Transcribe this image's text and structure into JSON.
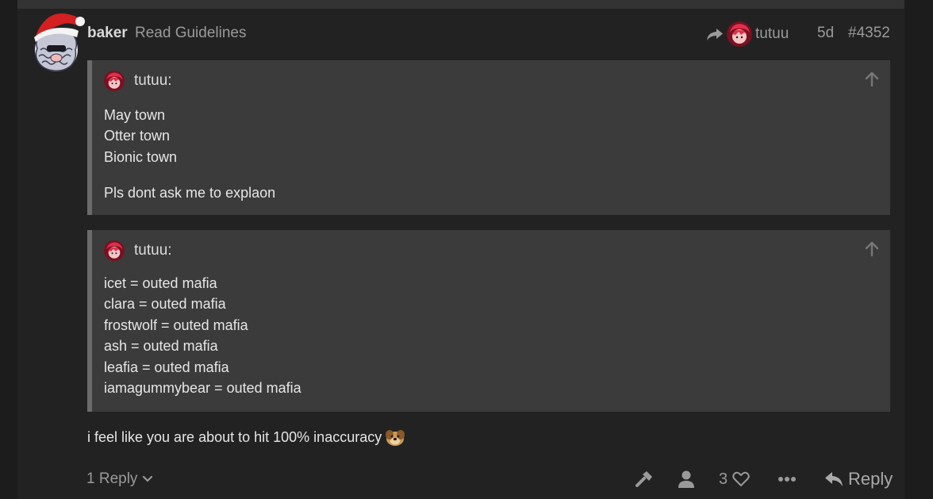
{
  "post": {
    "username": "baker",
    "user_title": "Read Guidelines",
    "reply_to_user": "tutuu",
    "date": "5d",
    "number": "#4352",
    "text": "i feel like you are about to hit 100% inaccuracy"
  },
  "quotes": [
    {
      "author": "tutuu:",
      "lines": [
        "May town",
        "Otter town",
        "Bionic town"
      ],
      "extra_line": "Pls dont ask me to explaon"
    },
    {
      "author": "tutuu:",
      "lines": [
        "icet = outed mafia",
        "clara = outed mafia",
        "frostwolf = outed mafia",
        "ash = outed mafia",
        "leafia = outed mafia",
        "iamagummybear = outed mafia"
      ]
    }
  ],
  "footer": {
    "replies_label": "1 Reply",
    "like_count": "3",
    "reply_label": "Reply"
  },
  "icons": {
    "avatar": "santa-hat-avatar",
    "reply_arrow": "share-arrow-icon",
    "quote_toggle": "arrow-up-icon",
    "admin": "wrench-icon",
    "user": "user-icon",
    "like": "heart-icon",
    "more": "ellipsis-icon",
    "reply": "reply-icon"
  },
  "colors": {
    "background": "#1c1c1c",
    "post_bg": "#222222",
    "quote_bg": "#3b3b3b",
    "quote_border": "#6b6b6b",
    "muted_text": "#9a9a9a"
  }
}
